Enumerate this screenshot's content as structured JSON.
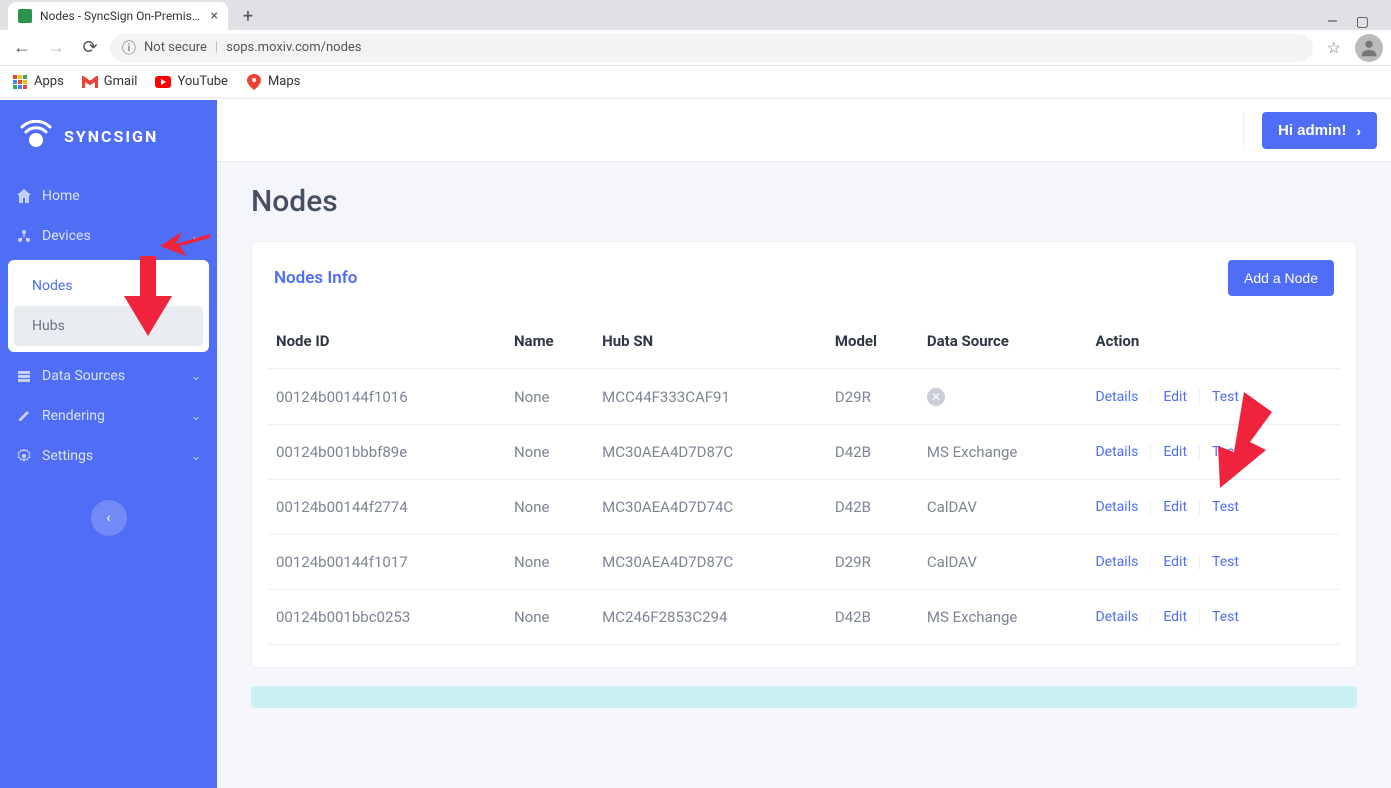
{
  "browser": {
    "tab_title": "Nodes - SyncSign On-Premise Se",
    "url_insecure_label": "Not secure",
    "url": "sops.moxiv.com/nodes",
    "bookmarks": {
      "apps": "Apps",
      "gmail": "Gmail",
      "youtube": "YouTube",
      "maps": "Maps"
    }
  },
  "brand": "SYNCSIGN",
  "nav": {
    "home": "Home",
    "devices": "Devices",
    "nodes": "Nodes",
    "hubs": "Hubs",
    "data_sources": "Data Sources",
    "rendering": "Rendering",
    "settings": "Settings"
  },
  "topbar": {
    "greeting": "Hi admin!"
  },
  "page": {
    "title": "Nodes",
    "card_title": "Nodes Info",
    "add_button": "Add a Node"
  },
  "table": {
    "headers": {
      "node_id": "Node ID",
      "name": "Name",
      "hub_sn": "Hub SN",
      "model": "Model",
      "data_source": "Data Source",
      "action": "Action"
    },
    "action_labels": {
      "details": "Details",
      "edit": "Edit",
      "test": "Test"
    },
    "rows": [
      {
        "node_id": "00124b00144f1016",
        "name": "None",
        "hub_sn": "MCC44F333CAF91",
        "model": "D29R",
        "data_source": ""
      },
      {
        "node_id": "00124b001bbbf89e",
        "name": "None",
        "hub_sn": "MC30AEA4D7D87C",
        "model": "D42B",
        "data_source": "MS Exchange"
      },
      {
        "node_id": "00124b00144f2774",
        "name": "None",
        "hub_sn": "MC30AEA4D7D74C",
        "model": "D42B",
        "data_source": "CalDAV"
      },
      {
        "node_id": "00124b00144f1017",
        "name": "None",
        "hub_sn": "MC30AEA4D7D87C",
        "model": "D29R",
        "data_source": "CalDAV"
      },
      {
        "node_id": "00124b001bbc0253",
        "name": "None",
        "hub_sn": "MC246F2853C294",
        "model": "D42B",
        "data_source": "MS Exchange"
      }
    ]
  }
}
